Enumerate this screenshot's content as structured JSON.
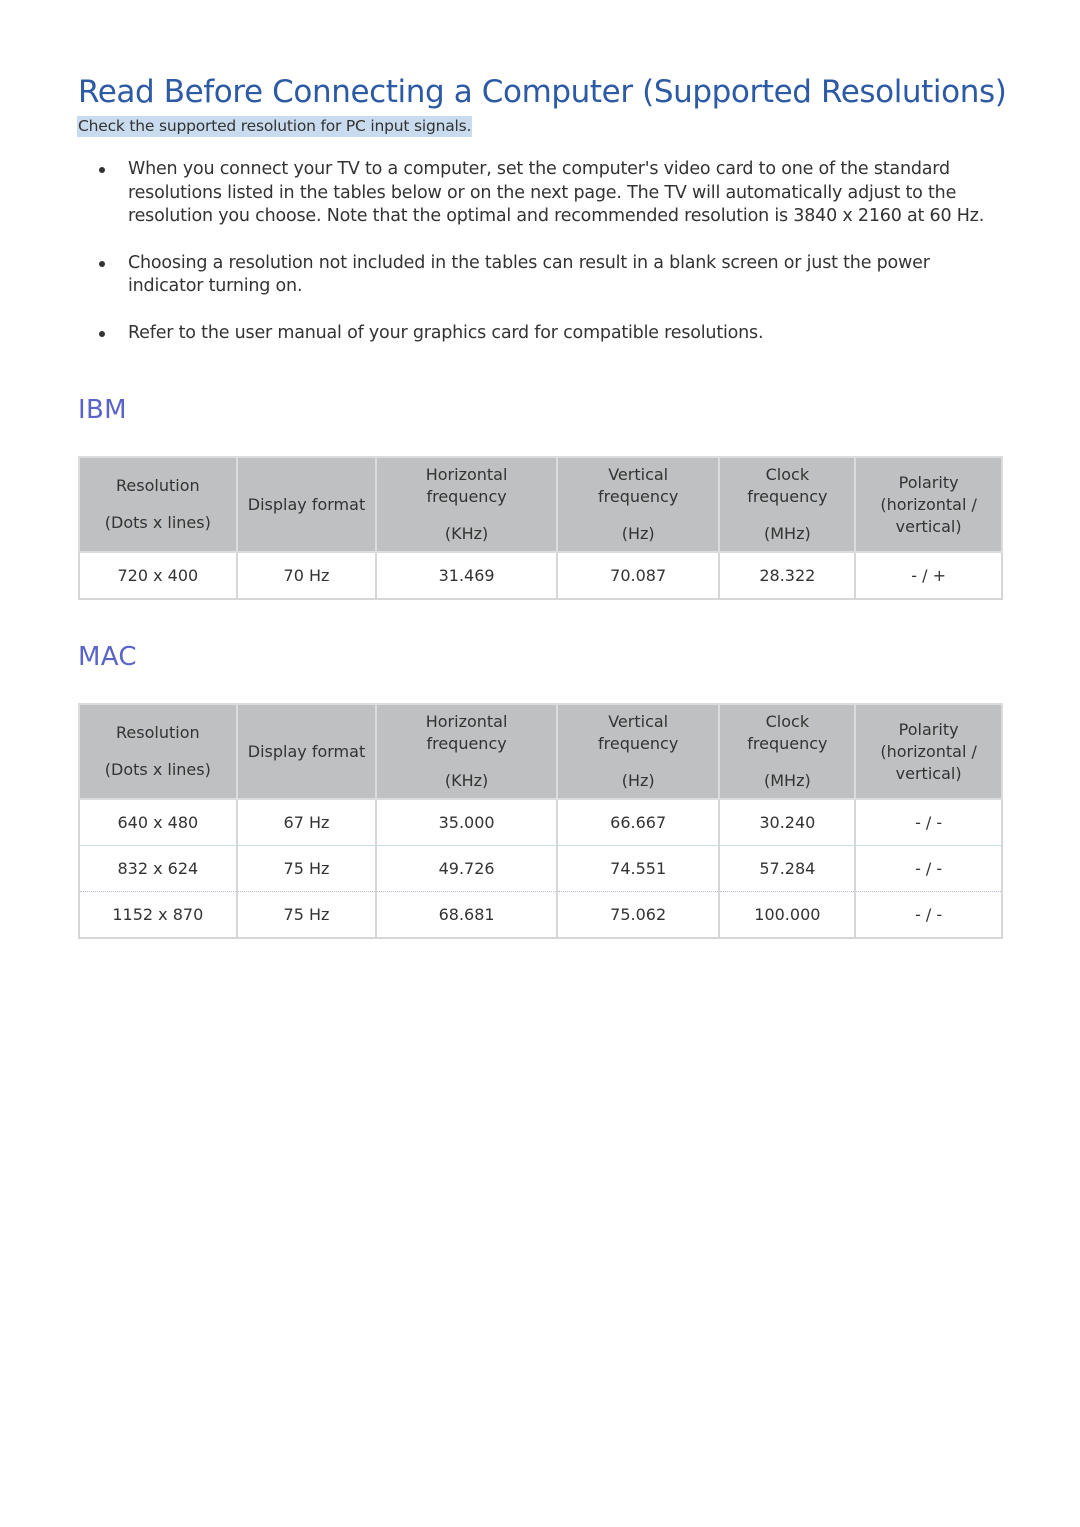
{
  "title": "Read Before Connecting a Computer (Supported Resolutions)",
  "subtitle": "Check the supported resolution for PC input signals.",
  "bullets": [
    "When you connect your TV to a computer, set the computer's video card to one of the standard resolutions listed in the tables below or on the next page. The TV will automatically adjust to the resolution you choose. Note that the optimal and recommended resolution is 3840 x 2160 at 60 Hz.",
    "Choosing a resolution not included in the tables can result in a blank screen or just the power indicator turning on.",
    "Refer to the user manual of your graphics card for compatible resolutions."
  ],
  "headers": {
    "resolution": "Resolution",
    "resolution_unit": "(Dots x lines)",
    "display_format": "Display format",
    "horizontal_1": "Horizontal",
    "horizontal_2": "frequency",
    "horizontal_unit": "(KHz)",
    "vertical_1": "Vertical",
    "vertical_2": "frequency",
    "vertical_unit": "(Hz)",
    "clock_1": "Clock",
    "clock_2": "frequency",
    "clock_unit": "(MHz)",
    "polarity_1": "Polarity",
    "polarity_2": "(horizontal /",
    "polarity_3": "vertical)"
  },
  "sections": {
    "ibm": {
      "heading": "IBM",
      "rows": [
        [
          "720 x 400",
          "70 Hz",
          "31.469",
          "70.087",
          "28.322",
          "- / +"
        ]
      ]
    },
    "mac": {
      "heading": "MAC",
      "rows": [
        [
          "640 x 480",
          "67 Hz",
          "35.000",
          "66.667",
          "30.240",
          "- / -"
        ],
        [
          "832 x 624",
          "75 Hz",
          "49.726",
          "74.551",
          "57.284",
          "- / -"
        ],
        [
          "1152 x 870",
          "75 Hz",
          "68.681",
          "75.062",
          "100.000",
          "- / -"
        ]
      ]
    }
  },
  "colors": {
    "title": "#2d5aa5",
    "section_heading": "#5a64c8",
    "subtitle_highlight": "#c9dcef",
    "table_header_bg": "#bfc0c1"
  }
}
